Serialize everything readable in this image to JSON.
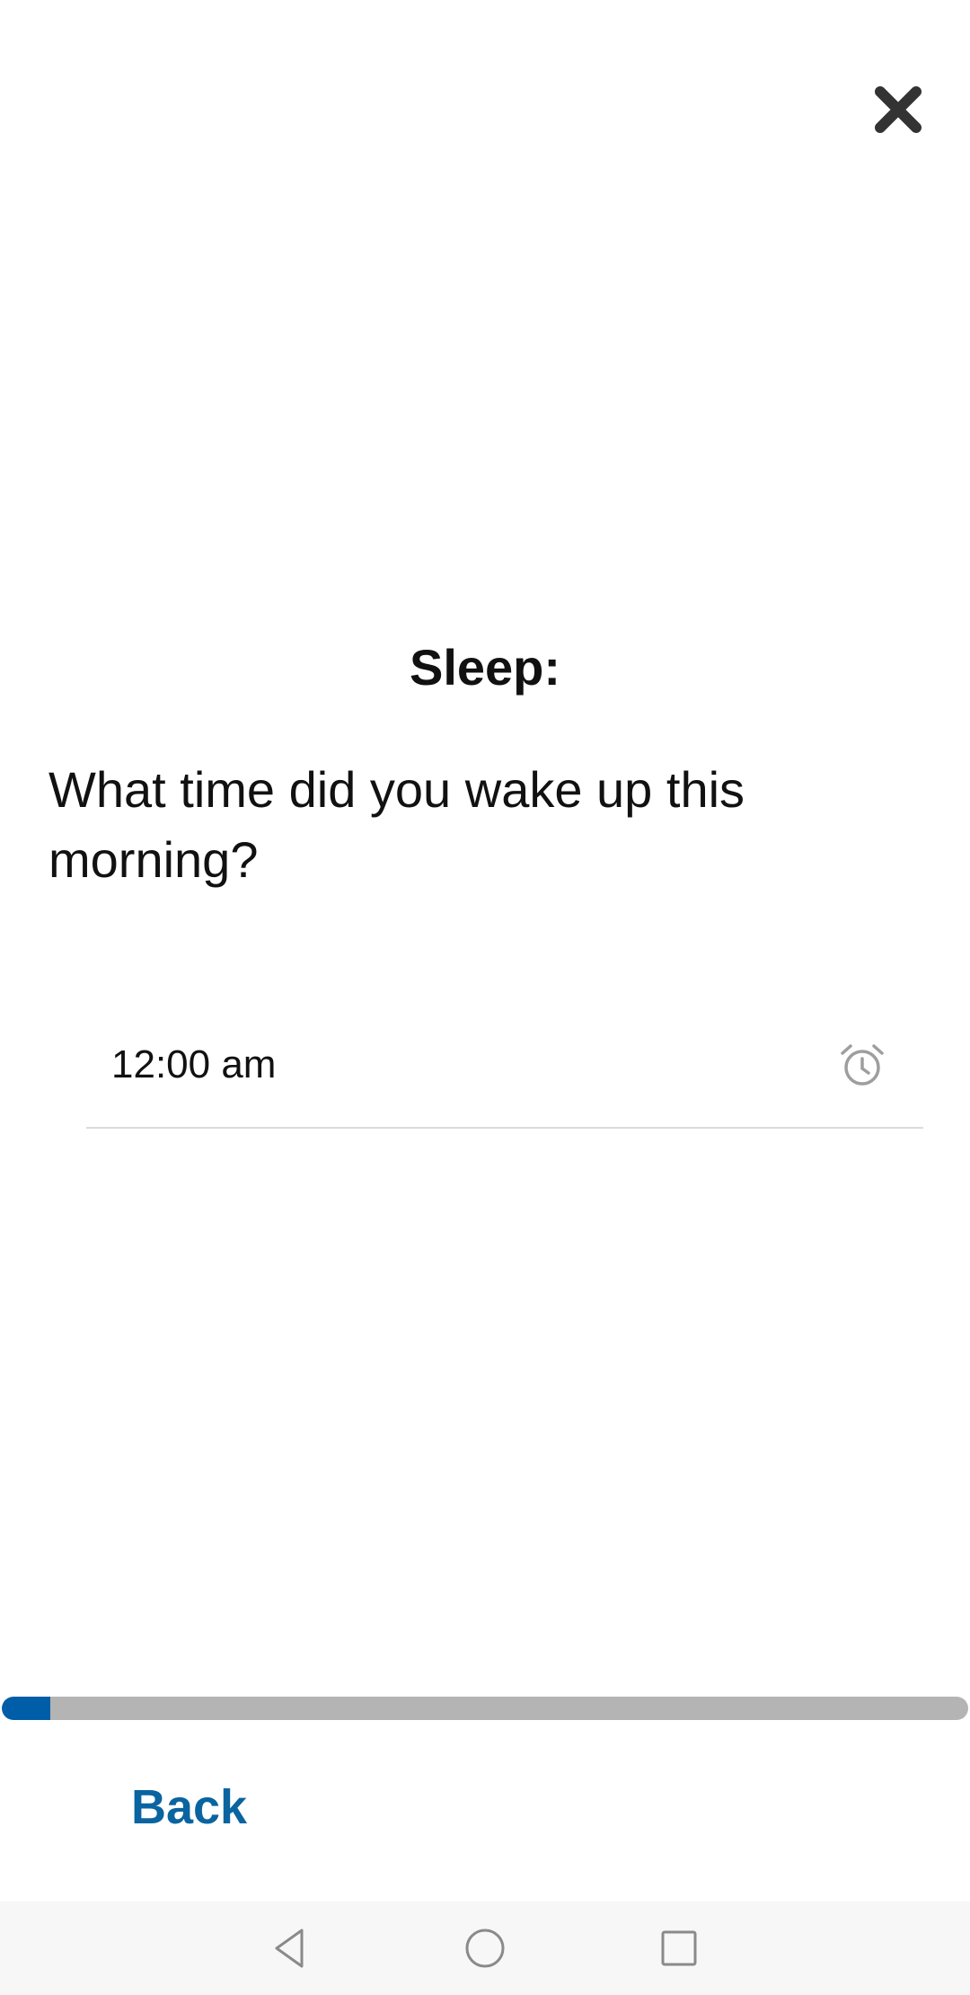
{
  "header": {
    "close_icon": "close-icon"
  },
  "content": {
    "section_title": "Sleep:",
    "question": "What time did you wake up this morning?",
    "time_field": {
      "value": "12:00 am",
      "icon": "alarm-clock-icon"
    }
  },
  "progress": {
    "fraction": 0.05,
    "fill_color": "#005ea8",
    "track_color": "#b4b4b4"
  },
  "footer": {
    "back_label": "Back"
  },
  "nav_bar": {
    "back_icon": "nav-back-icon",
    "home_icon": "nav-home-icon",
    "recents_icon": "nav-recents-icon"
  },
  "colors": {
    "accent": "#0a64a0",
    "text": "#111111"
  }
}
